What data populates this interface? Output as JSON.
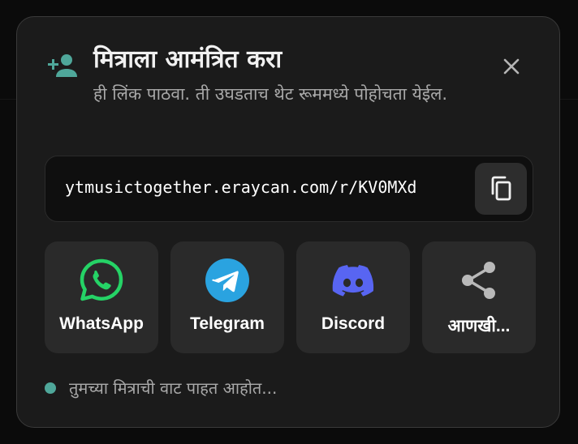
{
  "dialog": {
    "title": "मित्राला आमंत्रित करा",
    "subtitle": "ही लिंक पाठवा. ती उघडताच थेट रूममध्ये पोहोचता येईल.",
    "invite_icon": "person-add-icon",
    "close_icon": "close-icon"
  },
  "link": {
    "url": "ytmusictogether.eraycan.com/r/KV0MXd",
    "copy_icon": "copy-icon"
  },
  "share": {
    "items": [
      {
        "label": "WhatsApp",
        "icon": "whatsapp-icon",
        "color": "#25D366"
      },
      {
        "label": "Telegram",
        "icon": "telegram-icon",
        "color": "#2AA3E0"
      },
      {
        "label": "Discord",
        "icon": "discord-icon",
        "color": "#5865F2"
      },
      {
        "label": "आणखी...",
        "icon": "share-icon",
        "color": "#b9b9b9"
      }
    ]
  },
  "status": {
    "text": "तुमच्या मित्राची वाट पाहत आहोत...",
    "dot_color": "#4fa79a"
  },
  "colors": {
    "accent": "#4fa79a",
    "dialog_bg": "#1b1b1b",
    "tile_bg": "#2a2a2a"
  }
}
